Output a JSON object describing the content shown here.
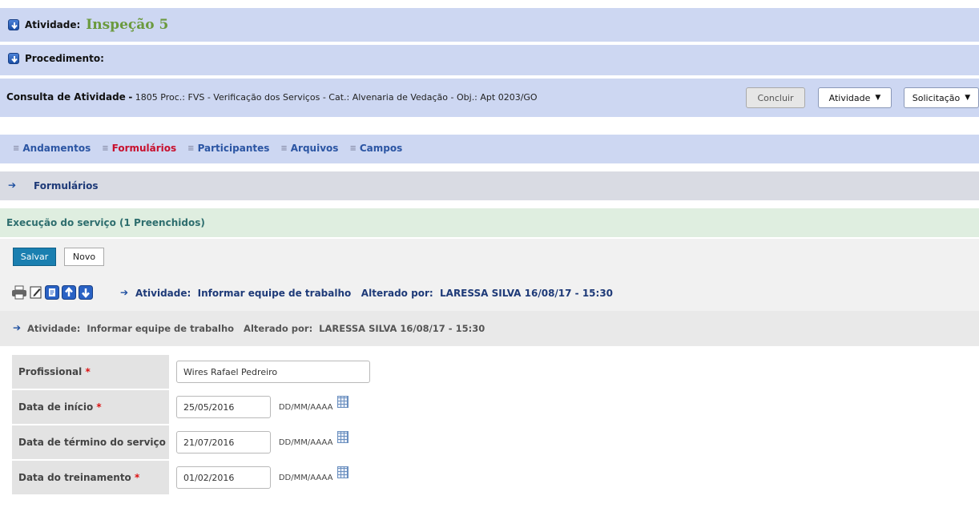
{
  "activity": {
    "label": "Atividade:",
    "value": "Inspeção 5"
  },
  "procedure": {
    "label": "Procedimento:"
  },
  "consult": {
    "title": "Consulta de Atividade",
    "separator": "-",
    "details": "1805 Proc.: FVS - Verificação dos Serviços - Cat.: Alvenaria de Vedação - Obj.: Apt 0203/GO",
    "buttons": {
      "conclude": "Concluir",
      "activity": "Atividade",
      "request": "Solicitação"
    }
  },
  "tabs": [
    {
      "label": "Andamentos",
      "active": false
    },
    {
      "label": "Formulários",
      "active": true
    },
    {
      "label": "Participantes",
      "active": false
    },
    {
      "label": "Arquivos",
      "active": false
    },
    {
      "label": "Campos",
      "active": false
    }
  ],
  "section": {
    "title": "Formulários"
  },
  "execution": {
    "title": "Execução do serviço (1 Preenchidos)",
    "save_label": "Salvar",
    "new_label": "Novo"
  },
  "history": {
    "line1": "Atividade:  Informar equipe de trabalho   Alterado por:  LARESSA SILVA 16/08/17 - 15:30",
    "line2": "Atividade:  Informar equipe de trabalho   Alterado por:  LARESSA SILVA 16/08/17 - 15:30"
  },
  "form": {
    "professional": {
      "label": "Profissional",
      "required": "*",
      "value": "Wires Rafael Pedreiro"
    },
    "start_date": {
      "label": "Data de início",
      "required": "*",
      "value": "25/05/2016",
      "format": "DD/MM/AAAA"
    },
    "end_date": {
      "label": "Data de término do serviço",
      "value": "21/07/2016",
      "format": "DD/MM/AAAA"
    },
    "training_date": {
      "label": "Data do treinamento",
      "required": "*",
      "value": "01/02/2016",
      "format": "DD/MM/AAAA"
    }
  },
  "colors": {
    "header_blue": "#cdd7f2",
    "accent_green": "#6b9a3e",
    "link_blue": "#2b55a3",
    "active_red": "#c8102e",
    "save_button": "#1a7fb0"
  }
}
